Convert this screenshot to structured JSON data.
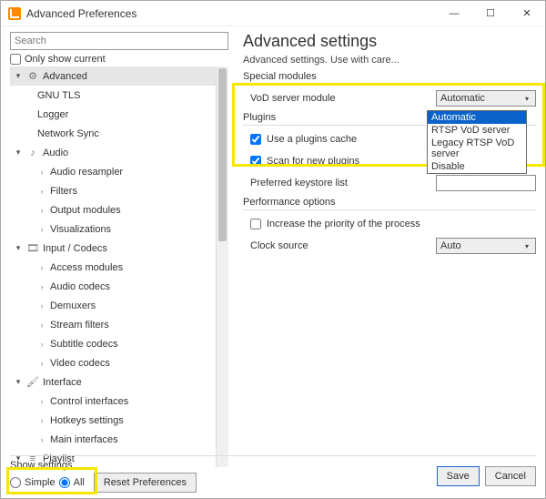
{
  "window": {
    "title": "Advanced Preferences",
    "min": "—",
    "max": "☐",
    "close": "✕"
  },
  "search": {
    "placeholder": "Search"
  },
  "only_show_current": "Only show current",
  "tree": {
    "advanced": "Advanced",
    "gnu_tls": "GNU TLS",
    "logger": "Logger",
    "network_sync": "Network Sync",
    "audio": "Audio",
    "audio_resampler": "Audio resampler",
    "filters": "Filters",
    "output_modules": "Output modules",
    "visualizations": "Visualizations",
    "input_codecs": "Input / Codecs",
    "access_modules": "Access modules",
    "audio_codecs": "Audio codecs",
    "demuxers": "Demuxers",
    "stream_filters": "Stream filters",
    "subtitle_codecs": "Subtitle codecs",
    "video_codecs": "Video codecs",
    "interface": "Interface",
    "control_interfaces": "Control interfaces",
    "hotkeys_settings": "Hotkeys settings",
    "main_interfaces": "Main interfaces",
    "playlist": "Playlist"
  },
  "right": {
    "heading": "Advanced settings",
    "subtitle": "Advanced settings. Use with care...",
    "special_modules": "Special modules",
    "vod_label": "VoD server module",
    "vod_value": "Automatic",
    "plugins": "Plugins",
    "use_plugins_cache": "Use a plugins cache",
    "scan_new_plugins": "Scan for new plugins",
    "preferred_keystore": "Preferred keystore list",
    "performance_options": "Performance options",
    "increase_priority": "Increase the priority of the process",
    "clock_source": "Clock source",
    "clock_value": "Auto",
    "dropdown_options": [
      "Automatic",
      "RTSP VoD server",
      "Legacy RTSP VoD server",
      "Disable"
    ]
  },
  "footer": {
    "show_settings": "Show settings",
    "simple": "Simple",
    "all": "All",
    "reset": "Reset Preferences",
    "save": "Save",
    "cancel": "Cancel"
  }
}
